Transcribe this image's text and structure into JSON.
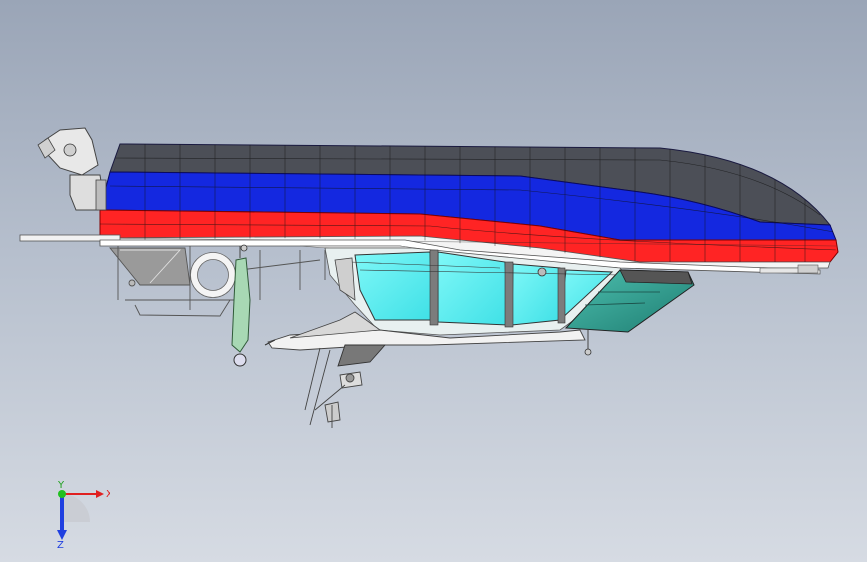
{
  "viewport": {
    "background_top": "#9aa5b7",
    "background_bottom": "#d6dbe3"
  },
  "colors": {
    "hull_dark": "#4a4d55",
    "hull_blue": "#1428e0",
    "hull_red": "#ff2222",
    "cabin_cyan": "#5ff2f2",
    "window_teal": "#2a9a8a",
    "structure_grey": "#7a7a7a"
  },
  "triad": {
    "x_label": "X",
    "y_label": "Y",
    "z_label": "Z",
    "x_color": "#e02020",
    "y_color": "#20c020",
    "z_color": "#2040e0"
  }
}
